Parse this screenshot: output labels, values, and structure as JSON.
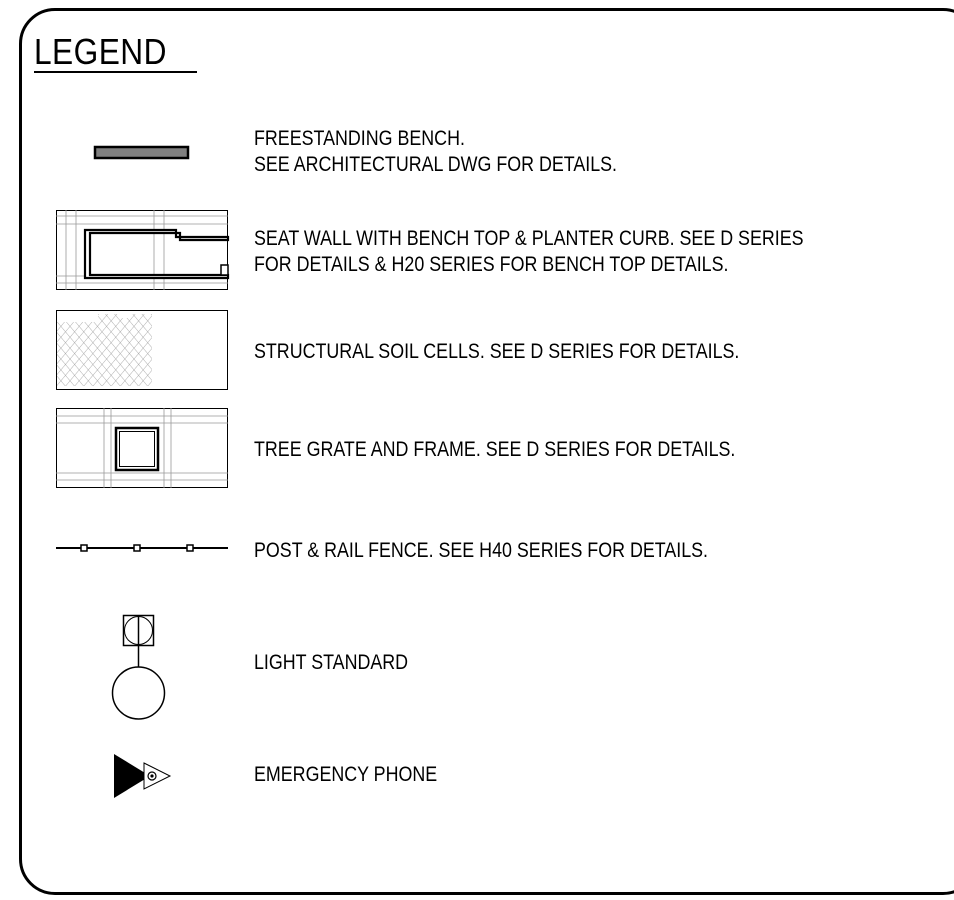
{
  "legend": {
    "title": "LEGEND",
    "items": [
      {
        "icon": "freestanding-bench-symbol",
        "lines": [
          "FREESTANDING BENCH.",
          "SEE ARCHITECTURAL DWG FOR DETAILS."
        ]
      },
      {
        "icon": "seat-wall-symbol",
        "lines": [
          "SEAT WALL WITH BENCH TOP & PLANTER CURB. SEE D SERIES",
          "FOR DETAILS & H20 SERIES FOR BENCH TOP DETAILS."
        ]
      },
      {
        "icon": "structural-soil-cells-symbol",
        "lines": [
          "STRUCTURAL SOIL CELLS. SEE D SERIES FOR DETAILS."
        ]
      },
      {
        "icon": "tree-grate-symbol",
        "lines": [
          "TREE GRATE AND FRAME. SEE D SERIES FOR DETAILS."
        ]
      },
      {
        "icon": "post-rail-fence-symbol",
        "lines": [
          "POST & RAIL FENCE. SEE H40 SERIES FOR DETAILS."
        ]
      },
      {
        "icon": "light-standard-symbol",
        "lines": [
          "LIGHT STANDARD"
        ]
      },
      {
        "icon": "emergency-phone-symbol",
        "lines": [
          "EMERGENCY PHONE"
        ]
      }
    ]
  },
  "colors": {
    "line": "#000000",
    "bench_fill": "#808080",
    "hatch": "#9a9a9a",
    "background": "#ffffff"
  }
}
